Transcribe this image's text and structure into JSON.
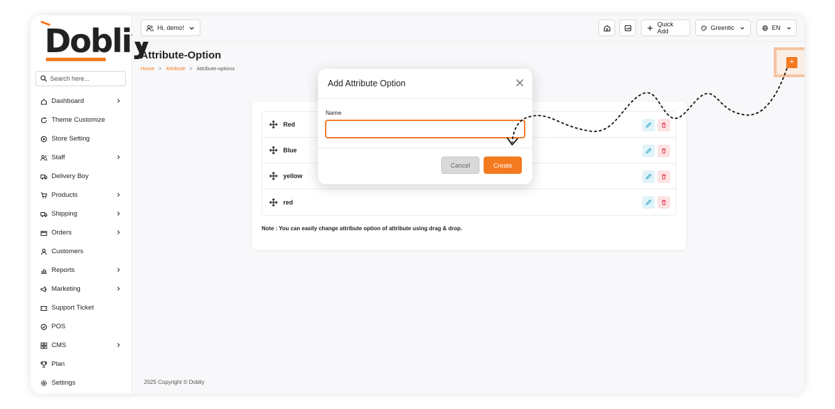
{
  "brand": {
    "logo_text": "Dobliy",
    "accent_color": "#f47a20"
  },
  "sidebar": {
    "search_placeholder": "Search here...",
    "items": [
      {
        "label": "Dashboard",
        "icon": "home-icon",
        "has_children": true
      },
      {
        "label": "Theme Customize",
        "icon": "refresh-icon",
        "has_children": false
      },
      {
        "label": "Store Setting",
        "icon": "settings-circle-icon",
        "has_children": false
      },
      {
        "label": "Staff",
        "icon": "users-icon",
        "has_children": true
      },
      {
        "label": "Delivery Boy",
        "icon": "truck-icon",
        "has_children": false
      },
      {
        "label": "Products",
        "icon": "cart-icon",
        "has_children": true
      },
      {
        "label": "Shipping",
        "icon": "truck-icon",
        "has_children": true
      },
      {
        "label": "Orders",
        "icon": "box-icon",
        "has_children": true
      },
      {
        "label": "Customers",
        "icon": "user-icon",
        "has_children": false
      },
      {
        "label": "Reports",
        "icon": "chart-icon",
        "has_children": true
      },
      {
        "label": "Marketing",
        "icon": "megaphone-icon",
        "has_children": true
      },
      {
        "label": "Support Ticket",
        "icon": "ticket-icon",
        "has_children": false
      },
      {
        "label": "POS",
        "icon": "pos-icon",
        "has_children": false
      },
      {
        "label": "CMS",
        "icon": "cms-icon",
        "has_children": true
      },
      {
        "label": "Plan",
        "icon": "trophy-icon",
        "has_children": false
      },
      {
        "label": "Settings",
        "icon": "gear-icon",
        "has_children": false
      }
    ]
  },
  "header": {
    "user_greeting": "Hi, demo!",
    "quick_add": "Quick Add",
    "theme": "Greentic",
    "language": "EN"
  },
  "page": {
    "title": "Attribute-Option",
    "breadcrumb": [
      "Home",
      "Attribute",
      "Attribute-options"
    ]
  },
  "options": [
    "Red",
    "Blue",
    "yellow",
    "red"
  ],
  "note": "Note : You can easily change attribute option of attribute using drag & drop.",
  "footer": "2025 Copyright © Dobliy",
  "modal": {
    "title": "Add Attribute Option",
    "name_label": "Name",
    "name_value": "",
    "cancel": "Cancel",
    "create": "Create"
  }
}
